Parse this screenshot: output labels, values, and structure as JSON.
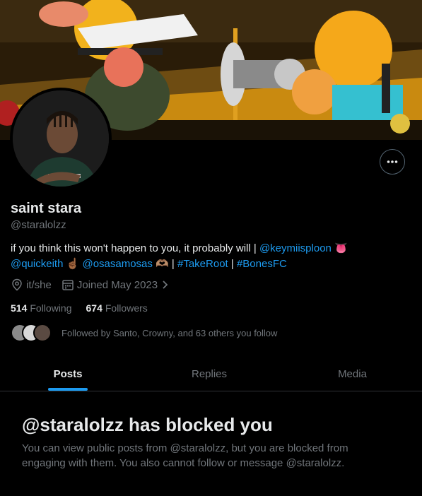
{
  "profile": {
    "display_name": "saint stara",
    "handle": "@staralolzz",
    "bio": {
      "text_1": "if you think this won't happen to you, it probably will | ",
      "mention_1": "@keymiisploon",
      "emoji_1": "👅",
      "mention_2": "@quickeith",
      "emoji_2": "☝🏾",
      "mention_3": "@osasamosas",
      "emoji_3": "🫶🏽",
      "sep_1": " | ",
      "hashtag_1": "#TakeRoot",
      "sep_2": " | ",
      "hashtag_2": "#BonesFC"
    },
    "pronouns": "it/she",
    "joined": "Joined May 2023",
    "following_count": "514",
    "following_label": "Following",
    "followers_count": "674",
    "followers_label": "Followers",
    "followed_by": "Followed by Santo, Crowny, and 63 others you follow"
  },
  "tabs": [
    {
      "label": "Posts",
      "active": true
    },
    {
      "label": "Replies",
      "active": false
    },
    {
      "label": "Media",
      "active": false
    }
  ],
  "blocked": {
    "title": "@staralolzz has blocked you",
    "description": "You can view public posts from @staralolzz, but you are blocked from engaging with them. You also cannot follow or message @staralolzz."
  },
  "colors": {
    "accent": "#1d9bf0",
    "background": "#000000",
    "text_primary": "#e7e9ea",
    "text_secondary": "#71767b",
    "border": "#2f3336"
  },
  "icons": {
    "more": "more-horizontal-icon",
    "location": "location-pin-icon",
    "calendar": "calendar-icon",
    "chevron": "chevron-right-icon"
  }
}
